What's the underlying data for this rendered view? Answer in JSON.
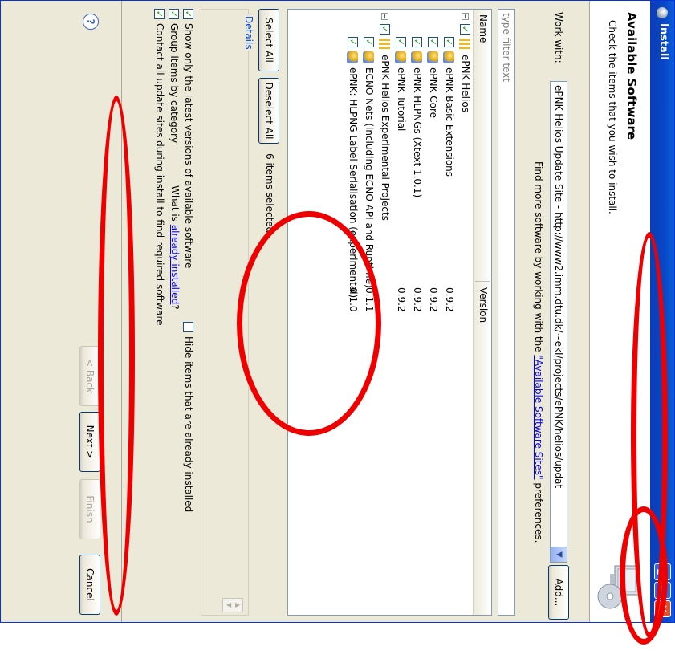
{
  "window": {
    "title": "Install",
    "controls": {
      "minimize": "_",
      "maximize": "□",
      "close": "✕"
    }
  },
  "banner": {
    "title": "Available Software",
    "description": "Check the items that you wish to install."
  },
  "work_with": {
    "label_prefix": "Work with:",
    "value": "ePNK Helios Update Site - http://www2.imm.dtu.dk/~ekI/projects/ePNK/helios/updat",
    "add_button": "Add...",
    "prefs_text": "Find more software by working with the",
    "prefs_link": "\"Available Software Sites\"",
    "prefs_suffix": "preferences."
  },
  "filter": {
    "placeholder": "type filter text"
  },
  "tree": {
    "columns": [
      "Name",
      "Version"
    ],
    "rows": [
      {
        "name": "ePNK Helios",
        "version": "",
        "level": 0,
        "checked": true,
        "kind": "category"
      },
      {
        "name": "ePNK Basic Extensions",
        "version": "0.9.2",
        "level": 1,
        "checked": true,
        "kind": "feature"
      },
      {
        "name": "ePNK Core",
        "version": "0.9.2",
        "level": 1,
        "checked": true,
        "kind": "feature"
      },
      {
        "name": "ePNK HLPNGs (Xtext 1.0.1)",
        "version": "0.9.2",
        "level": 1,
        "checked": true,
        "kind": "feature"
      },
      {
        "name": "ePNK Tutorial",
        "version": "0.9.2",
        "level": 1,
        "checked": true,
        "kind": "feature"
      },
      {
        "name": "ePNK Helios Experimental Projects",
        "version": "",
        "level": 0,
        "checked": true,
        "kind": "category"
      },
      {
        "name": "ECNO Nets (including ECNO API and Runtime)",
        "version": "0.1.1",
        "level": 1,
        "checked": true,
        "kind": "feature"
      },
      {
        "name": "ePNK: HLPNG Label Serialisation (experimental)",
        "version": "0.1.0",
        "level": 1,
        "checked": true,
        "kind": "feature"
      }
    ]
  },
  "selection": {
    "select_all": "Select All",
    "deselect_all": "Deselect All",
    "count": "6 items selected"
  },
  "details": {
    "label": "Details"
  },
  "options": {
    "latest_only": {
      "label": "Show only the latest versions of available software",
      "checked": true
    },
    "hide_installed": {
      "label": "Hide items that are already installed",
      "checked": false
    },
    "group_by_category": {
      "label": "Group items by category",
      "checked": true
    },
    "what_installed_prefix": "What is",
    "what_installed_link": "already installed",
    "what_installed_suffix": "?",
    "contact_sites": {
      "label": "Contact all update sites during install to find required software",
      "checked": true
    }
  },
  "footer": {
    "help": "?",
    "back": "< Back",
    "next": "Next >",
    "finish": "Finish",
    "cancel": "Cancel"
  },
  "colors": {
    "annotation": "#ee0000",
    "title_bar": "#0847c8",
    "dialog_background": "#ece9d8",
    "link": "#0000ff",
    "checkmark": "#21a121"
  }
}
